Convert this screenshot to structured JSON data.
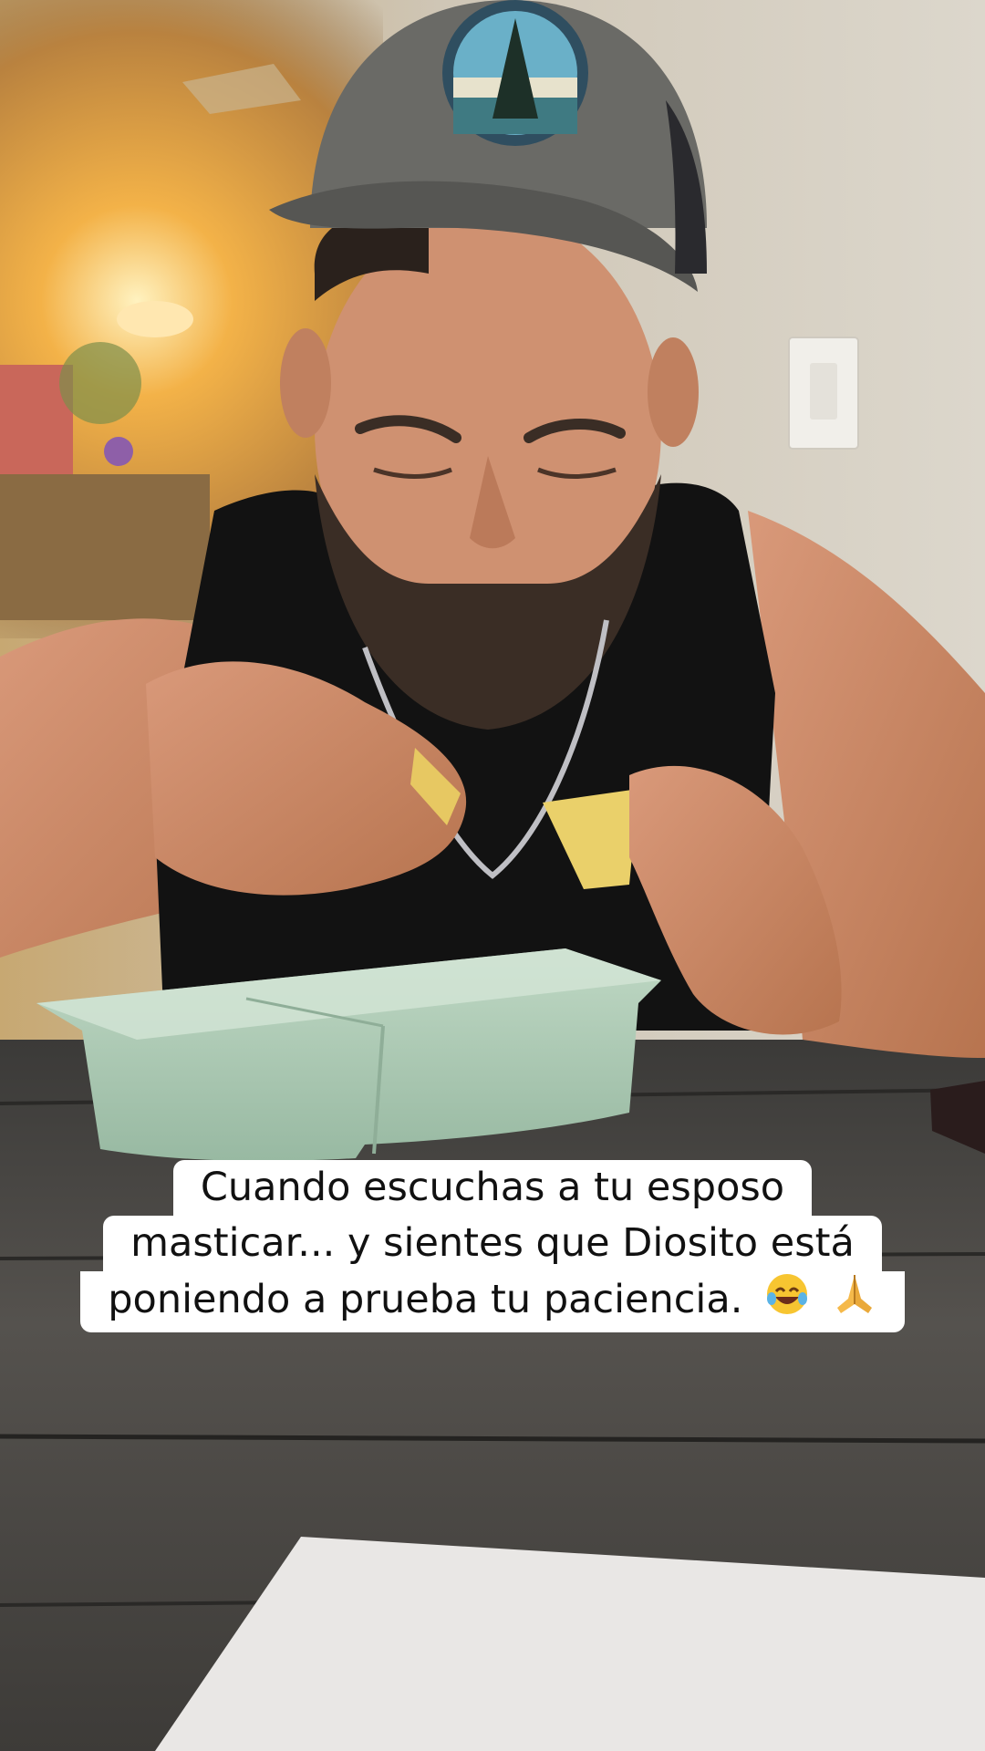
{
  "caption": {
    "line1": "Cuando escuchas a tu esposo",
    "line2": "masticar... y sientes que Diosito está",
    "line3": "poniendo a prueba tu paciencia."
  },
  "emojis": [
    "laughing-tears-icon",
    "praying-hands-icon"
  ],
  "colors": {
    "wall": "#d8d2c4",
    "lamp_glow": "#f3b248",
    "cap": "#6a6a66",
    "tank_top": "#121212",
    "skin": "#c98a64",
    "table": "#4a4845",
    "container": "#a9c9b2",
    "caption_bg": "#ffffff"
  }
}
